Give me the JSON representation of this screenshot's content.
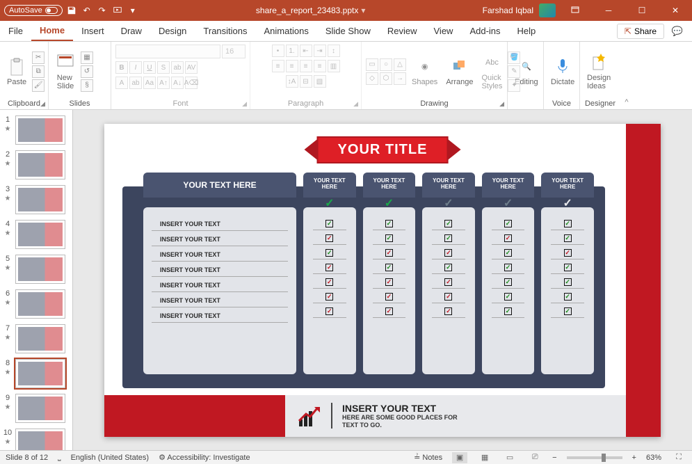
{
  "titlebar": {
    "autosave": "AutoSave",
    "filename": "share_a_report_23483.pptx",
    "user": "Farshad Iqbal"
  },
  "tabs": {
    "file": "File",
    "home": "Home",
    "insert": "Insert",
    "draw": "Draw",
    "design": "Design",
    "transitions": "Transitions",
    "animations": "Animations",
    "slideshow": "Slide Show",
    "review": "Review",
    "view": "View",
    "addins": "Add-ins",
    "help": "Help",
    "share": "Share"
  },
  "ribbon": {
    "clipboard": {
      "label": "Clipboard",
      "paste": "Paste"
    },
    "slides": {
      "label": "Slides",
      "new_slide": "New\nSlide"
    },
    "font": {
      "label": "Font",
      "size_ph": "16"
    },
    "paragraph": {
      "label": "Paragraph"
    },
    "drawing": {
      "label": "Drawing",
      "shapes": "Shapes",
      "arrange": "Arrange",
      "quick": "Quick\nStyles"
    },
    "editing": {
      "label": "Editing",
      "editing_btn": "Editing"
    },
    "voice": {
      "label": "Voice",
      "dictate": "Dictate"
    },
    "designer": {
      "label": "Designer",
      "ideas": "Design\nIdeas"
    }
  },
  "slide": {
    "title": "YOUR TITLE",
    "header_main": "YOUR TEXT HERE",
    "header_col": "YOUR TEXT\nHERE",
    "rows": [
      "INSERT YOUR TEXT",
      "INSERT YOUR TEXT",
      "INSERT YOUR TEXT",
      "INSERT YOUR TEXT",
      "INSERT YOUR TEXT",
      "INSERT YOUR TEXT",
      "INSERT YOUR TEXT"
    ],
    "bottom_heading": "INSERT YOUR TEXT",
    "bottom_sub1": "HERE ARE SOME GOOD PLACES FOR",
    "bottom_sub2": "TEXT TO GO."
  },
  "status": {
    "slide": "Slide 8 of 12",
    "lang": "English (United States)",
    "access": "Accessibility: Investigate",
    "notes": "Notes",
    "zoom": "63%"
  },
  "thumbs": {
    "count": 10,
    "active": 8
  }
}
